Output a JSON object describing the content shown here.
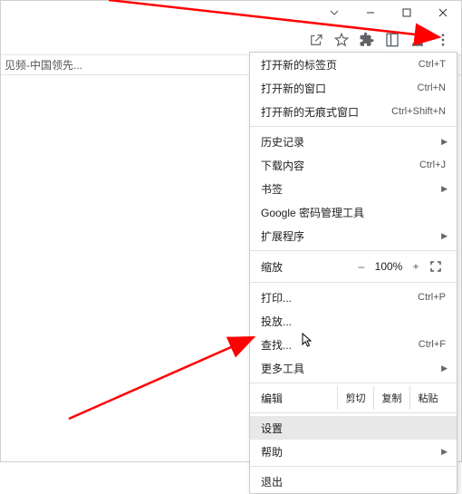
{
  "page": {
    "tab_title": "见频-中国领先..."
  },
  "menu": {
    "new_tab": {
      "label": "打开新的标签页",
      "shortcut": "Ctrl+T"
    },
    "new_window": {
      "label": "打开新的窗口",
      "shortcut": "Ctrl+N"
    },
    "incognito": {
      "label": "打开新的无痕式窗口",
      "shortcut": "Ctrl+Shift+N"
    },
    "history": {
      "label": "历史记录"
    },
    "downloads": {
      "label": "下载内容",
      "shortcut": "Ctrl+J"
    },
    "bookmarks": {
      "label": "书签"
    },
    "passwords": {
      "label": "Google 密码管理工具"
    },
    "extensions": {
      "label": "扩展程序"
    },
    "zoom": {
      "label": "缩放",
      "minus": "–",
      "value": "100%",
      "plus": "+"
    },
    "print": {
      "label": "打印...",
      "shortcut": "Ctrl+P"
    },
    "cast": {
      "label": "投放..."
    },
    "find": {
      "label": "查找...",
      "shortcut": "Ctrl+F"
    },
    "more_tools": {
      "label": "更多工具"
    },
    "edit": {
      "label": "编辑",
      "cut": "剪切",
      "copy": "复制",
      "paste": "粘贴"
    },
    "settings": {
      "label": "设置"
    },
    "help": {
      "label": "帮助"
    },
    "exit": {
      "label": "退出"
    }
  },
  "annotation": {
    "color": "#ff0000",
    "highlights": [
      "menu-icon",
      "menu-settings"
    ]
  }
}
